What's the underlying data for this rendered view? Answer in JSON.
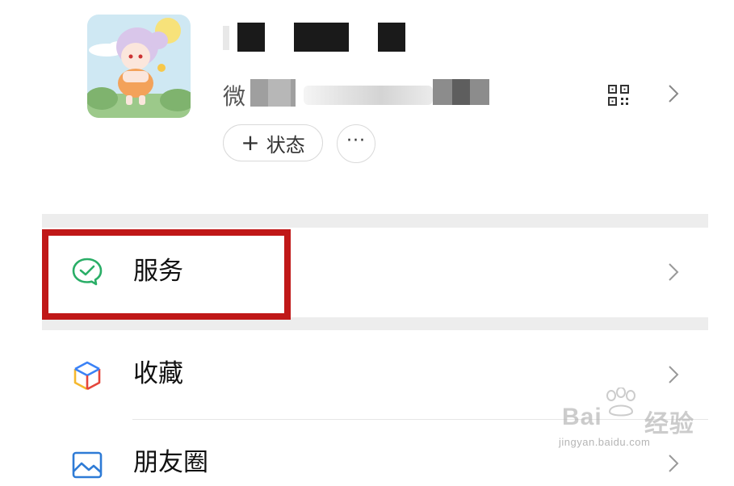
{
  "profile": {
    "wechat_id_label": "微",
    "status_button": {
      "plus": "+",
      "label": "状态"
    },
    "more_button": {
      "label": "···"
    },
    "qr_icon": "qr-code-icon",
    "chevron_icon": "chevron-right-icon"
  },
  "menu": {
    "services": {
      "label": "服务",
      "icon": "wechat-pay-icon"
    },
    "favorites": {
      "label": "收藏",
      "icon": "cube-icon"
    },
    "moments": {
      "label": "朋友圈",
      "icon": "image-icon"
    }
  },
  "highlight": {
    "color": "#c01818"
  },
  "watermark": {
    "brand": "Bai",
    "brand2": "经验",
    "site": "jingyan.baidu.com"
  },
  "colors": {
    "accent_green": "#2aae67",
    "separator": "#ededed"
  }
}
